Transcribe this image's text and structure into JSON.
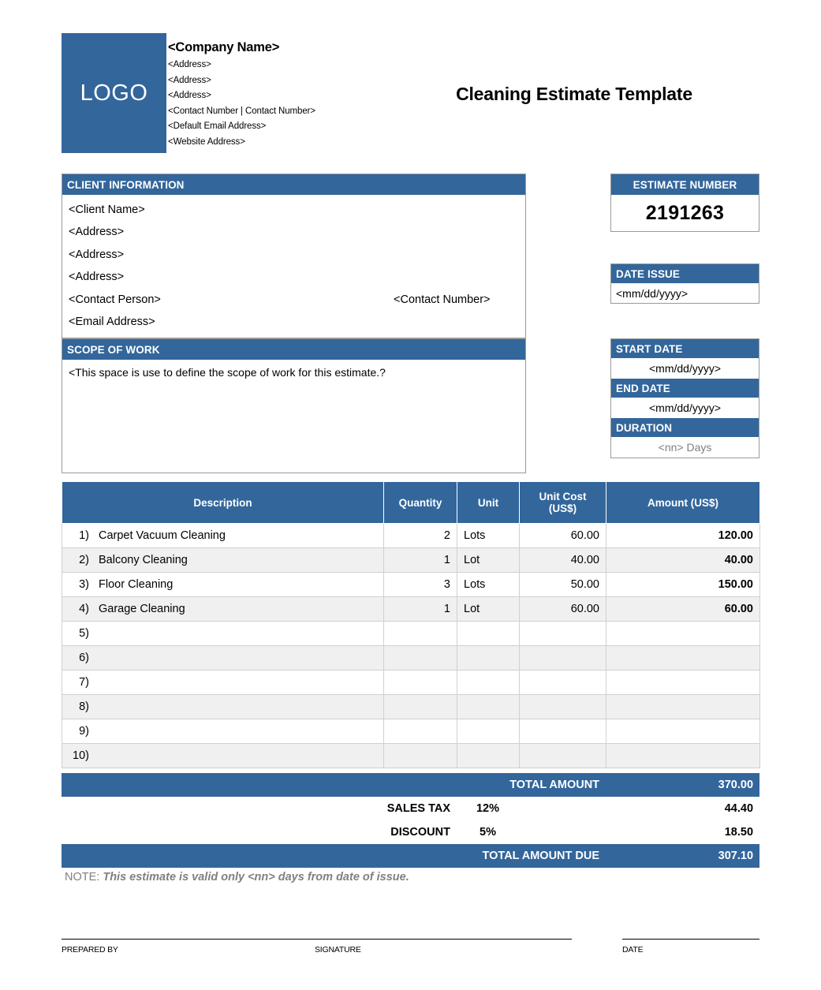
{
  "header": {
    "logo_label": "LOGO",
    "company_name": "<Company Name>",
    "company_lines": [
      "<Address>",
      "<Address>",
      "<Address>",
      "<Contact Number | Contact Number>",
      "<Default Email Address>",
      "<Website Address>"
    ],
    "doc_title": "Cleaning Estimate Template"
  },
  "client": {
    "section_title": "CLIENT INFORMATION",
    "name": "<Client Name>",
    "address1": "<Address>",
    "address2": "<Address>",
    "address3": "<Address>",
    "contact_person": "<Contact Person>",
    "contact_number": "<Contact Number>",
    "email": "<Email Address>"
  },
  "scope": {
    "section_title": "SCOPE OF WORK",
    "text": "<This space is use to define the scope of work for this estimate.?"
  },
  "estimate": {
    "number_label": "ESTIMATE NUMBER",
    "number_value": "2191263",
    "date_issue_label": "DATE ISSUE",
    "date_issue_value": "<mm/dd/yyyy>",
    "start_date_label": "START DATE",
    "start_date_value": "<mm/dd/yyyy>",
    "end_date_label": "END DATE",
    "end_date_value": "<mm/dd/yyyy>",
    "duration_label": "DURATION",
    "duration_value": "<nn> Days"
  },
  "table": {
    "columns": [
      "Description",
      "Quantity",
      "Unit",
      "Unit Cost\n(US$)",
      "Amount (US$)"
    ],
    "col_description": "Description",
    "col_quantity": "Quantity",
    "col_unit": "Unit",
    "col_unit_cost_l1": "Unit Cost",
    "col_unit_cost_l2": "(US$)",
    "col_amount": "Amount (US$)",
    "rows": [
      {
        "num": "1)",
        "description": "Carpet Vacuum Cleaning",
        "quantity": "2",
        "unit": "Lots",
        "unit_cost": "60.00",
        "amount": "120.00"
      },
      {
        "num": "2)",
        "description": "Balcony Cleaning",
        "quantity": "1",
        "unit": "Lot",
        "unit_cost": "40.00",
        "amount": "40.00"
      },
      {
        "num": "3)",
        "description": "Floor Cleaning",
        "quantity": "3",
        "unit": "Lots",
        "unit_cost": "50.00",
        "amount": "150.00"
      },
      {
        "num": "4)",
        "description": "Garage Cleaning",
        "quantity": "1",
        "unit": "Lot",
        "unit_cost": "60.00",
        "amount": "60.00"
      },
      {
        "num": "5)",
        "description": "",
        "quantity": "",
        "unit": "",
        "unit_cost": "",
        "amount": ""
      },
      {
        "num": "6)",
        "description": "",
        "quantity": "",
        "unit": "",
        "unit_cost": "",
        "amount": ""
      },
      {
        "num": "7)",
        "description": "",
        "quantity": "",
        "unit": "",
        "unit_cost": "",
        "amount": ""
      },
      {
        "num": "8)",
        "description": "",
        "quantity": "",
        "unit": "",
        "unit_cost": "",
        "amount": ""
      },
      {
        "num": "9)",
        "description": "",
        "quantity": "",
        "unit": "",
        "unit_cost": "",
        "amount": ""
      },
      {
        "num": "10)",
        "description": "",
        "quantity": "",
        "unit": "",
        "unit_cost": "",
        "amount": ""
      }
    ]
  },
  "totals": {
    "total_amount_label": "TOTAL AMOUNT",
    "total_amount_value": "370.00",
    "sales_tax_label": "SALES TAX",
    "sales_tax_pct": "12%",
    "sales_tax_value": "44.40",
    "discount_label": "DISCOUNT",
    "discount_pct": "5%",
    "discount_value": "18.50",
    "total_due_label": "TOTAL AMOUNT DUE",
    "total_due_value": "307.10"
  },
  "note": {
    "label": "NOTE: ",
    "text": "This estimate is valid only <nn> days from date of issue."
  },
  "footer": {
    "prepared_by": "PREPARED BY",
    "signature": "SIGNATURE",
    "date": "DATE"
  },
  "colors": {
    "brand_blue": "#33669b",
    "row_alt": "#f0f0f0",
    "muted_gray": "#808080"
  }
}
